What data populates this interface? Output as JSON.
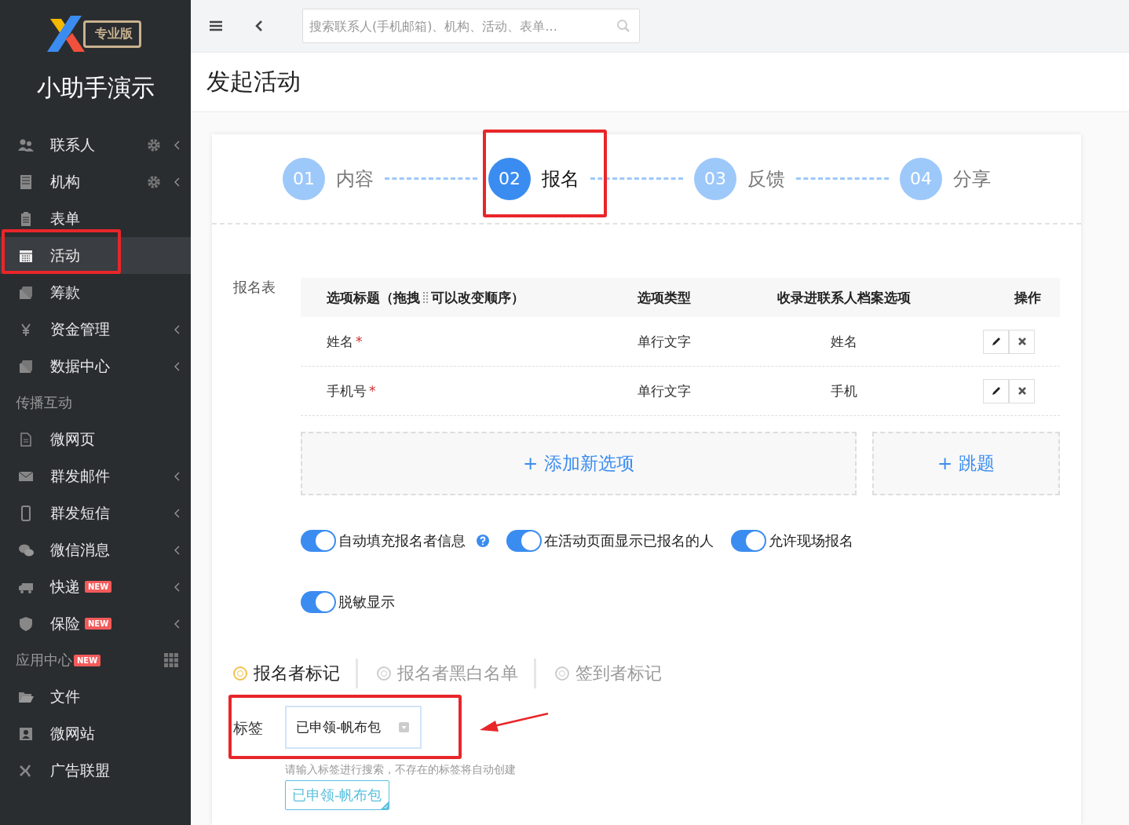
{
  "brand": {
    "edition": "专业版",
    "name": "小助手演示"
  },
  "sidebar": [
    {
      "kind": "item",
      "label": "联系人",
      "settings": true,
      "submenu": true,
      "selected": false
    },
    {
      "kind": "item",
      "label": "机构",
      "settings": true,
      "submenu": true,
      "selected": false
    },
    {
      "kind": "item",
      "label": "表单",
      "settings": false,
      "submenu": false,
      "selected": false
    },
    {
      "kind": "item",
      "label": "活动",
      "settings": false,
      "submenu": false,
      "selected": true
    },
    {
      "kind": "item",
      "label": "筹款",
      "settings": false,
      "submenu": false,
      "selected": false
    },
    {
      "kind": "item",
      "label": "资金管理",
      "settings": false,
      "submenu": true,
      "selected": false
    },
    {
      "kind": "item",
      "label": "数据中心",
      "settings": false,
      "submenu": true,
      "selected": false
    },
    {
      "kind": "section",
      "label": "传播互动"
    },
    {
      "kind": "item",
      "label": "微网页",
      "settings": false,
      "submenu": false,
      "selected": false
    },
    {
      "kind": "item",
      "label": "群发邮件",
      "settings": false,
      "submenu": true,
      "selected": false
    },
    {
      "kind": "item",
      "label": "群发短信",
      "settings": false,
      "submenu": true,
      "selected": false
    },
    {
      "kind": "item",
      "label": "微信消息",
      "settings": false,
      "submenu": true,
      "selected": false
    },
    {
      "kind": "item",
      "label": "快递",
      "badge": "NEW",
      "settings": false,
      "submenu": true,
      "selected": false
    },
    {
      "kind": "item",
      "label": "保险",
      "badge": "NEW",
      "settings": false,
      "submenu": true,
      "selected": false
    },
    {
      "kind": "section",
      "label": "应用中心",
      "badge": "NEW",
      "grid": true
    },
    {
      "kind": "item",
      "label": "文件",
      "settings": false,
      "submenu": false,
      "selected": false
    },
    {
      "kind": "item",
      "label": "微网站",
      "settings": false,
      "submenu": false,
      "selected": false
    },
    {
      "kind": "item",
      "label": "广告联盟",
      "settings": false,
      "submenu": false,
      "selected": false
    }
  ],
  "search": {
    "placeholder": "搜索联系人(手机邮箱)、机构、活动、表单..."
  },
  "page_title": "发起活动",
  "steps": [
    {
      "number": "01",
      "label": "内容",
      "selected": false
    },
    {
      "number": "02",
      "label": "报名",
      "selected": true
    },
    {
      "number": "03",
      "label": "反馈",
      "selected": false
    },
    {
      "number": "04",
      "label": "分享",
      "selected": false
    }
  ],
  "form_label": "报名表",
  "table": {
    "columns": [
      "选项标题（拖拽",
      "可以改变顺序）",
      "选项类型",
      "收录进联系人档案选项",
      "操作"
    ],
    "rows": [
      {
        "title": "姓名",
        "mark": "*",
        "type": "单行文字",
        "field": "姓名"
      },
      {
        "title": "手机号",
        "mark": "*",
        "type": "单行文字",
        "field": "手机"
      }
    ]
  },
  "add_buttons": [
    "+ 添加新选项",
    "+ 跳题"
  ],
  "toggles": [
    {
      "label": "自动填充报名者信息",
      "on": true,
      "help": true
    },
    {
      "label": "在活动页面显示已报名的人",
      "on": true,
      "help": false
    },
    {
      "label": "允许现场报名",
      "on": true,
      "help": false
    },
    {
      "label": "脱敏显示",
      "on": true,
      "help": false
    }
  ],
  "tag_tabs": [
    {
      "label": "报名者标记",
      "selected": true
    },
    {
      "label": "报名者黑白名单",
      "selected": false
    },
    {
      "label": "签到者标记",
      "selected": false
    }
  ],
  "tag_field": {
    "label": "标签",
    "value": "已申领-帆布包",
    "hint": "请输入标签进行搜索，不存在的标签将自动创建",
    "chips": [
      "已申领-帆布包"
    ]
  }
}
